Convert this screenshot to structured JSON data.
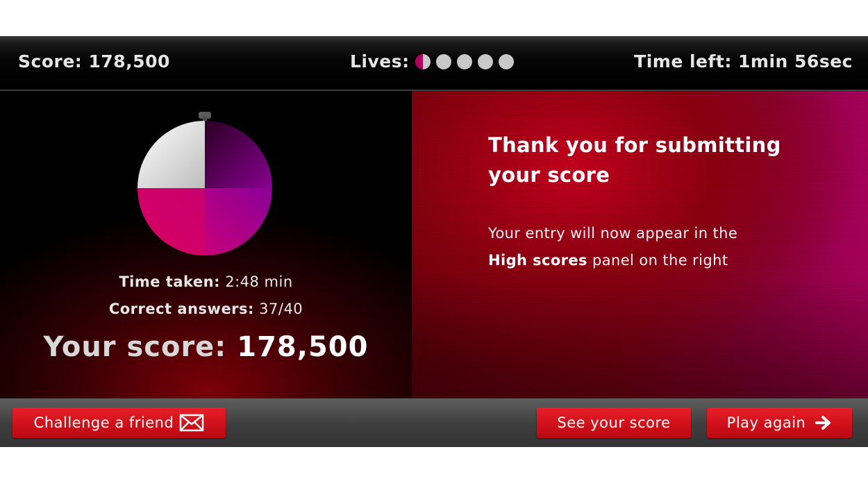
{
  "status_bar": {
    "score_label": "Score: 178,500",
    "lives_label": "Lives:",
    "lives": {
      "total": 5,
      "remaining": 0.5
    },
    "time_left_label": "Time left: 1min 56sec"
  },
  "results": {
    "time_taken_label": "Time taken:",
    "time_taken_value": "2:48 min",
    "correct_answers_label": "Correct answers:",
    "correct_answers_value": "37/40",
    "your_score_label": "Your score:",
    "your_score_value": "178,500",
    "timer_pie": {
      "elapsed_fraction": 0.75,
      "remaining_fraction": 0.25,
      "colors": {
        "remaining": "#e6e6e6",
        "elapsed_start": "#3c0030",
        "elapsed_mid": "#8a0080",
        "elapsed_end": "#cc0066"
      }
    }
  },
  "message": {
    "title_line1": "Thank you for submitting",
    "title_line2": "your score",
    "body_line1": "Your entry will now appear in the",
    "body_bold": "High scores",
    "body_rest": " panel on the right"
  },
  "buttons": {
    "challenge_label": "Challenge a friend",
    "challenge_icon": "envelope-icon",
    "see_score_label": "See your score",
    "play_again_label": "Play again",
    "play_again_icon": "arrow-right-icon"
  },
  "colors": {
    "button_red": "#d0101a",
    "life_active": "#b3005e",
    "life_inactive": "#c8c8c8"
  }
}
